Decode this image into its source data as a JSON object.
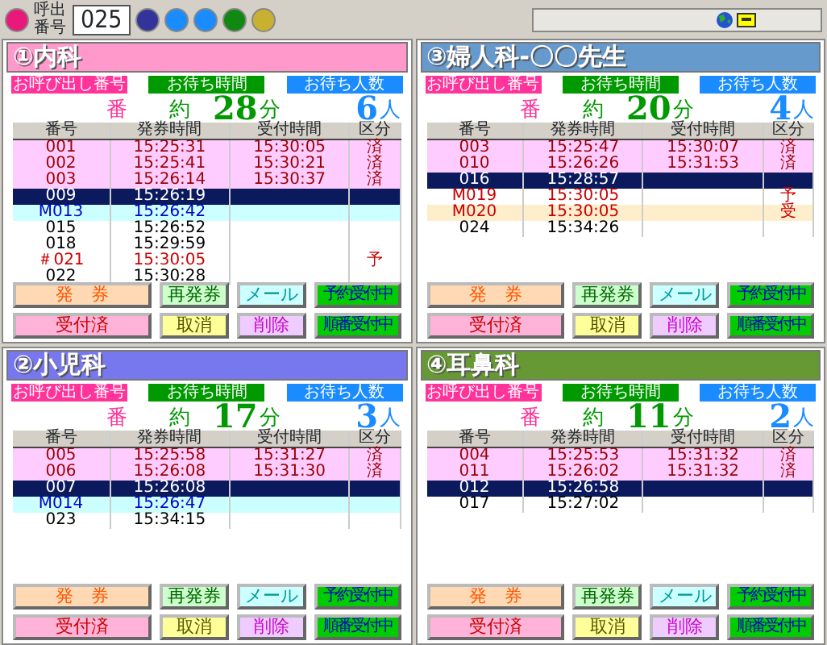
{
  "toolbar": {
    "round_buttons": [
      {
        "color": "#e8197a"
      },
      {
        "color": "#333399"
      },
      {
        "color": "#1a8cff"
      },
      {
        "color": "#1a8cff"
      },
      {
        "color": "#118811"
      },
      {
        "color": "#c8b030"
      }
    ],
    "call_label": "呼出番号",
    "call_number": "025"
  },
  "panels": [
    {
      "title": "①内科",
      "color": "#ff99cc",
      "labels": [
        "お呼び出し番号",
        "お待ち時間",
        "お待ち人数"
      ],
      "number_mark": "番",
      "wait_mark": "約",
      "minutes": "28",
      "minutes_unit": "分",
      "count": "6",
      "count_unit": "人",
      "columns": [
        "番号",
        "発券時間",
        "受付時間",
        "区分"
      ],
      "rows": [
        {
          "number": "001",
          "issued": "15:25:31",
          "accepted": "15:30:05",
          "category": "済",
          "kind": "done"
        },
        {
          "number": "002",
          "issued": "15:25:41",
          "accepted": "15:30:21",
          "category": "済",
          "kind": "done"
        },
        {
          "number": "003",
          "issued": "15:26:14",
          "accepted": "15:30:37",
          "category": "済",
          "kind": "done"
        },
        {
          "number": "009",
          "issued": "15:26:19",
          "kind": "current"
        },
        {
          "number": "M013",
          "issued": "15:26:42",
          "kind": "mail"
        },
        {
          "number": "015",
          "issued": "15:26:52",
          "kind": "waiting"
        },
        {
          "number": "018",
          "issued": "15:29:59",
          "kind": "waiting"
        },
        {
          "number": "＃021",
          "issued": "15:30:05",
          "category": "予",
          "kind": "reserved"
        },
        {
          "number": "022",
          "issued": "15:30:28",
          "kind": "waiting"
        }
      ],
      "buttons": [
        {
          "label": "発　券",
          "kind": "issue"
        },
        {
          "label": "再発券",
          "kind": "reissue"
        },
        {
          "label": "メール",
          "kind": "mail"
        },
        {
          "label": "予約受付中",
          "kind": "reserve"
        },
        {
          "label": "受付済",
          "kind": "accepted"
        },
        {
          "label": "取消",
          "kind": "cancel"
        },
        {
          "label": "削除",
          "kind": "delete"
        },
        {
          "label": "順番受付中",
          "kind": "sequence"
        }
      ]
    },
    {
      "title": "③婦人科-〇〇先生",
      "color": "#6699cc",
      "labels": [
        "お呼び出し番号",
        "お待ち時間",
        "お待ち人数"
      ],
      "number_mark": "番",
      "wait_mark": "約",
      "minutes": "20",
      "minutes_unit": "分",
      "count": "4",
      "count_unit": "人",
      "columns": [
        "番号",
        "発券時間",
        "受付時間",
        "区分"
      ],
      "rows": [
        {
          "number": "003",
          "issued": "15:25:47",
          "accepted": "15:30:07",
          "category": "済",
          "kind": "done"
        },
        {
          "number": "010",
          "issued": "15:26:26",
          "accepted": "15:31:53",
          "category": "済",
          "kind": "done"
        },
        {
          "number": "016",
          "issued": "15:28:57",
          "kind": "current"
        },
        {
          "number": "M019",
          "issued": "15:30:05",
          "category": "予",
          "kind": "reserved"
        },
        {
          "number": "M020",
          "issued": "15:30:05",
          "category": "受",
          "kind": "received"
        },
        {
          "number": "024",
          "issued": "15:34:26",
          "kind": "waiting"
        }
      ],
      "buttons": [
        {
          "label": "発　券",
          "kind": "issue"
        },
        {
          "label": "再発券",
          "kind": "reissue"
        },
        {
          "label": "メール",
          "kind": "mail"
        },
        {
          "label": "予約受付中",
          "kind": "reserve"
        },
        {
          "label": "受付済",
          "kind": "accepted"
        },
        {
          "label": "取消",
          "kind": "cancel"
        },
        {
          "label": "削除",
          "kind": "delete"
        },
        {
          "label": "順番受付中",
          "kind": "sequence"
        }
      ]
    },
    {
      "title": "②小児科",
      "color": "#7777ee",
      "labels": [
        "お呼び出し番号",
        "お待ち時間",
        "お待ち人数"
      ],
      "number_mark": "番",
      "wait_mark": "約",
      "minutes": "17",
      "minutes_unit": "分",
      "count": "3",
      "count_unit": "人",
      "columns": [
        "番号",
        "発券時間",
        "受付時間",
        "区分"
      ],
      "rows": [
        {
          "number": "005",
          "issued": "15:25:58",
          "accepted": "15:31:27",
          "category": "済",
          "kind": "done"
        },
        {
          "number": "006",
          "issued": "15:26:08",
          "accepted": "15:31:30",
          "category": "済",
          "kind": "done"
        },
        {
          "number": "007",
          "issued": "15:26:08",
          "kind": "current"
        },
        {
          "number": "M014",
          "issued": "15:26:47",
          "kind": "mail"
        },
        {
          "number": "023",
          "issued": "15:34:15",
          "kind": "waiting"
        }
      ],
      "buttons": [
        {
          "label": "発　券",
          "kind": "issue"
        },
        {
          "label": "再発券",
          "kind": "reissue"
        },
        {
          "label": "メール",
          "kind": "mail"
        },
        {
          "label": "予約受付中",
          "kind": "reserve"
        },
        {
          "label": "受付済",
          "kind": "accepted"
        },
        {
          "label": "取消",
          "kind": "cancel"
        },
        {
          "label": "削除",
          "kind": "delete"
        },
        {
          "label": "順番受付中",
          "kind": "sequence"
        }
      ]
    },
    {
      "title": "④耳鼻科",
      "color": "#669933",
      "labels": [
        "お呼び出し番号",
        "お待ち時間",
        "お待ち人数"
      ],
      "number_mark": "番",
      "wait_mark": "約",
      "minutes": "11",
      "minutes_unit": "分",
      "count": "2",
      "count_unit": "人",
      "columns": [
        "番号",
        "発券時間",
        "受付時間",
        "区分"
      ],
      "rows": [
        {
          "number": "004",
          "issued": "15:25:53",
          "accepted": "15:31:32",
          "category": "済",
          "kind": "done"
        },
        {
          "number": "011",
          "issued": "15:26:02",
          "accepted": "15:31:32",
          "category": "済",
          "kind": "done"
        },
        {
          "number": "012",
          "issued": "15:26:58",
          "kind": "current"
        },
        {
          "number": "017",
          "issued": "15:27:02",
          "kind": "waiting"
        }
      ],
      "buttons": [
        {
          "label": "発　券",
          "kind": "issue"
        },
        {
          "label": "再発券",
          "kind": "reissue"
        },
        {
          "label": "メール",
          "kind": "mail"
        },
        {
          "label": "予約受付中",
          "kind": "reserve"
        },
        {
          "label": "受付済",
          "kind": "accepted"
        },
        {
          "label": "取消",
          "kind": "cancel"
        },
        {
          "label": "削除",
          "kind": "delete"
        },
        {
          "label": "順番受付中",
          "kind": "sequence"
        }
      ]
    }
  ]
}
